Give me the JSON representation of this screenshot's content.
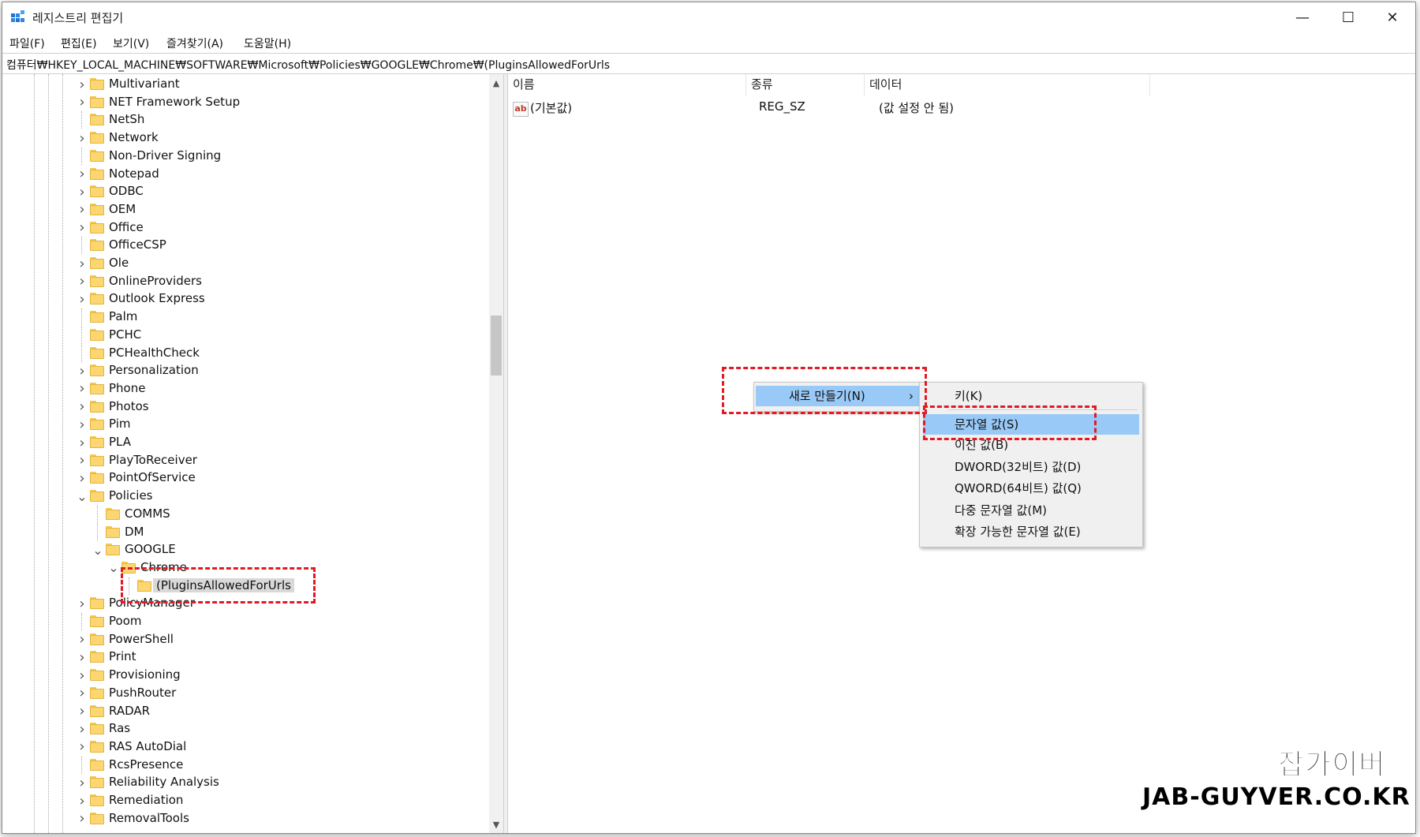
{
  "window": {
    "title": "레지스트리 편집기",
    "minimize": "—",
    "maximize": "☐",
    "close": "✕"
  },
  "menu": [
    "파일(F)",
    "편집(E)",
    "보기(V)",
    "즐겨찾기(A)",
    "도움말(H)"
  ],
  "address": "컴퓨터₩HKEY_LOCAL_MACHINE₩SOFTWARE₩Microsoft₩Policies₩GOOGLE₩Chrome₩(PluginsAllowedForUrls",
  "tree": [
    {
      "label": "Multivariant",
      "depth": 0,
      "expander": "closed"
    },
    {
      "label": "NET Framework Setup",
      "depth": 0,
      "expander": "closed"
    },
    {
      "label": "NetSh",
      "depth": 0,
      "expander": "none"
    },
    {
      "label": "Network",
      "depth": 0,
      "expander": "closed"
    },
    {
      "label": "Non-Driver Signing",
      "depth": 0,
      "expander": "none"
    },
    {
      "label": "Notepad",
      "depth": 0,
      "expander": "closed"
    },
    {
      "label": "ODBC",
      "depth": 0,
      "expander": "closed"
    },
    {
      "label": "OEM",
      "depth": 0,
      "expander": "closed"
    },
    {
      "label": "Office",
      "depth": 0,
      "expander": "closed"
    },
    {
      "label": "OfficeCSP",
      "depth": 0,
      "expander": "none"
    },
    {
      "label": "Ole",
      "depth": 0,
      "expander": "closed"
    },
    {
      "label": "OnlineProviders",
      "depth": 0,
      "expander": "closed"
    },
    {
      "label": "Outlook Express",
      "depth": 0,
      "expander": "closed"
    },
    {
      "label": "Palm",
      "depth": 0,
      "expander": "none"
    },
    {
      "label": "PCHC",
      "depth": 0,
      "expander": "none"
    },
    {
      "label": "PCHealthCheck",
      "depth": 0,
      "expander": "none"
    },
    {
      "label": "Personalization",
      "depth": 0,
      "expander": "closed"
    },
    {
      "label": "Phone",
      "depth": 0,
      "expander": "closed"
    },
    {
      "label": "Photos",
      "depth": 0,
      "expander": "closed"
    },
    {
      "label": "Pim",
      "depth": 0,
      "expander": "closed"
    },
    {
      "label": "PLA",
      "depth": 0,
      "expander": "closed"
    },
    {
      "label": "PlayToReceiver",
      "depth": 0,
      "expander": "closed"
    },
    {
      "label": "PointOfService",
      "depth": 0,
      "expander": "closed"
    },
    {
      "label": "Policies",
      "depth": 0,
      "expander": "open"
    },
    {
      "label": "COMMS",
      "depth": 1,
      "expander": "none"
    },
    {
      "label": "DM",
      "depth": 1,
      "expander": "none"
    },
    {
      "label": "GOOGLE",
      "depth": 1,
      "expander": "open"
    },
    {
      "label": "Chrome",
      "depth": 2,
      "expander": "open"
    },
    {
      "label": "(PluginsAllowedForUrls",
      "depth": 3,
      "expander": "none",
      "selected": true
    },
    {
      "label": "PolicyManager",
      "depth": 0,
      "expander": "closed"
    },
    {
      "label": "Poom",
      "depth": 0,
      "expander": "none"
    },
    {
      "label": "PowerShell",
      "depth": 0,
      "expander": "closed"
    },
    {
      "label": "Print",
      "depth": 0,
      "expander": "closed"
    },
    {
      "label": "Provisioning",
      "depth": 0,
      "expander": "closed"
    },
    {
      "label": "PushRouter",
      "depth": 0,
      "expander": "closed"
    },
    {
      "label": "RADAR",
      "depth": 0,
      "expander": "closed"
    },
    {
      "label": "Ras",
      "depth": 0,
      "expander": "closed"
    },
    {
      "label": "RAS AutoDial",
      "depth": 0,
      "expander": "closed"
    },
    {
      "label": "RcsPresence",
      "depth": 0,
      "expander": "none"
    },
    {
      "label": "Reliability Analysis",
      "depth": 0,
      "expander": "closed"
    },
    {
      "label": "Remediation",
      "depth": 0,
      "expander": "closed"
    },
    {
      "label": "RemovalTools",
      "depth": 0,
      "expander": "closed"
    }
  ],
  "columns": {
    "name": "이름",
    "type": "종류",
    "data": "데이터"
  },
  "values": [
    {
      "name": "(기본값)",
      "type": "REG_SZ",
      "data": "(값 설정 안 됨)",
      "icon": "ab"
    }
  ],
  "context_menu": {
    "new_label": "새로 만들기(N)",
    "arrow": "›"
  },
  "submenu": [
    {
      "label": "키(K)"
    },
    {
      "label": "문자열 값(S)",
      "highlighted": true
    },
    {
      "label": "이진 값(B)"
    },
    {
      "label": "DWORD(32비트) 값(D)"
    },
    {
      "label": "QWORD(64비트) 값(Q)"
    },
    {
      "label": "다중 문자열 값(M)"
    },
    {
      "label": "확장 가능한 문자열 값(E)"
    }
  ],
  "watermark": {
    "line1": "잡가이버",
    "line2": "JAB-GUYVER.CO.KR"
  }
}
